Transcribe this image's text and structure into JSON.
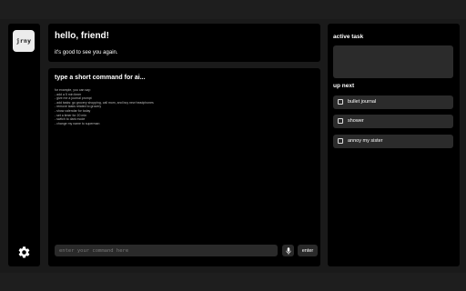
{
  "sidebar": {
    "logo_text": "jrny",
    "settings_icon": "gear-icon"
  },
  "greeting": {
    "title": "hello, friend!",
    "subtitle": "it's good to see you again."
  },
  "command": {
    "title": "type a short command for ai...",
    "examples": [
      "for example, you can say:",
      "- add a 5 min timer",
      "- give me a journal prompt",
      "- add tasks: go grocery shopping, call mom, and buy new headphones",
      "- remove tasks related to grocery",
      "- show calendar for today",
      "- set a timer for 20 min",
      "- switch to dark mode",
      "- change my name to superman"
    ],
    "input_placeholder": "enter your command here",
    "mic_icon": "microphone-icon",
    "enter_label": "enter"
  },
  "tasks": {
    "active_heading": "active task",
    "up_next_heading": "up next",
    "items": [
      {
        "label": "bullet journal"
      },
      {
        "label": "shower"
      },
      {
        "label": "annoy my sister"
      }
    ]
  }
}
